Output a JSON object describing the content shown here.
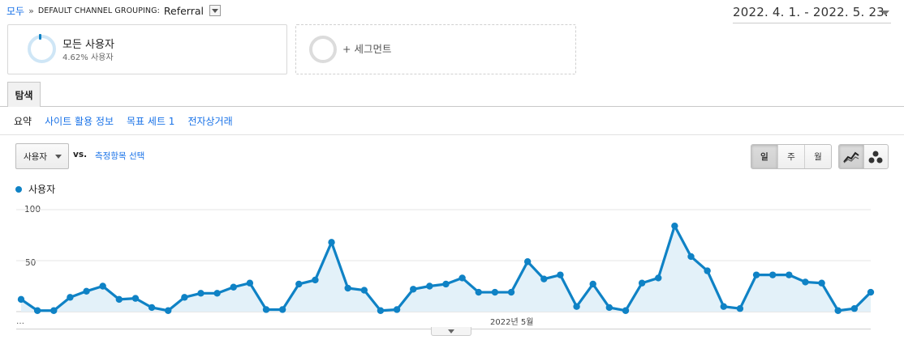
{
  "breadcrumb": {
    "home": "모두",
    "separator": "»",
    "dimension": "DEFAULT CHANNEL GROUPING:",
    "value": "Referral"
  },
  "date_range": "2022. 4. 1. - 2022. 5. 23.",
  "segments": [
    {
      "title": "모든 사용자",
      "subtitle": "4.62% 사용자"
    },
    {
      "add_label": "+ 세그먼트"
    }
  ],
  "tab": "탐색",
  "subtabs": [
    "요약",
    "사이트 활용 정보",
    "목표 세트 1",
    "전자상거래"
  ],
  "metric_selector": {
    "value": "사용자",
    "vs": "vs.",
    "choose": "측정항목 선택"
  },
  "period_buttons": [
    "일",
    "주",
    "월"
  ],
  "active_period": "일",
  "chart_type_buttons": [
    "line-chart-icon",
    "motion-chart-icon"
  ],
  "colors": {
    "series": "#0f82c5",
    "area": "#e3f1f9",
    "grid": "#e5e5e5"
  },
  "chart_data": {
    "type": "area",
    "series": [
      {
        "name": "사용자",
        "values": [
          12,
          1,
          1,
          14,
          20,
          25,
          12,
          13,
          4,
          1,
          14,
          18,
          18,
          24,
          28,
          2,
          2,
          27,
          31,
          68,
          23,
          21,
          1,
          2,
          22,
          25,
          27,
          33,
          19,
          19,
          19,
          49,
          32,
          36,
          5,
          27,
          4,
          1,
          28,
          33,
          84,
          54,
          40,
          5,
          3,
          36,
          36,
          36,
          29,
          28,
          1,
          3,
          19
        ]
      }
    ],
    "ylim": [
      0,
      100
    ],
    "yticks": [
      "100",
      "50"
    ],
    "x_labels": [
      "2022년 5월"
    ],
    "x_label_index": 30,
    "truncation_label": "…",
    "grid": true
  }
}
